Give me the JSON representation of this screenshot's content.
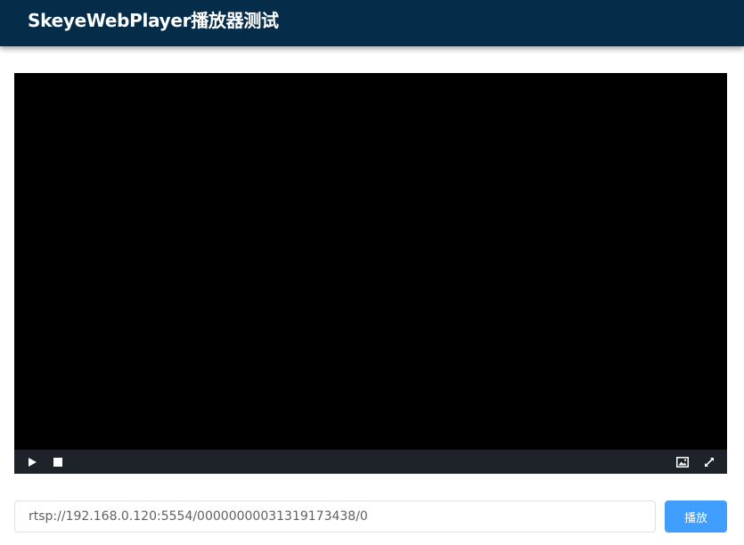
{
  "header": {
    "title": "SkeyeWebPlayer播放器测试"
  },
  "player": {
    "controls": {
      "play_icon": "play-icon",
      "stop_icon": "stop-icon",
      "snapshot_icon": "image-icon",
      "fullscreen_icon": "fullscreen-icon"
    }
  },
  "stream": {
    "url_value": "rtsp://192.168.0.120:5554/00000000031319173438/0",
    "play_label": "播放"
  },
  "colors": {
    "header_bg": "#052c49",
    "control_bar_bg": "#1e2329",
    "button_bg": "#409eff"
  }
}
